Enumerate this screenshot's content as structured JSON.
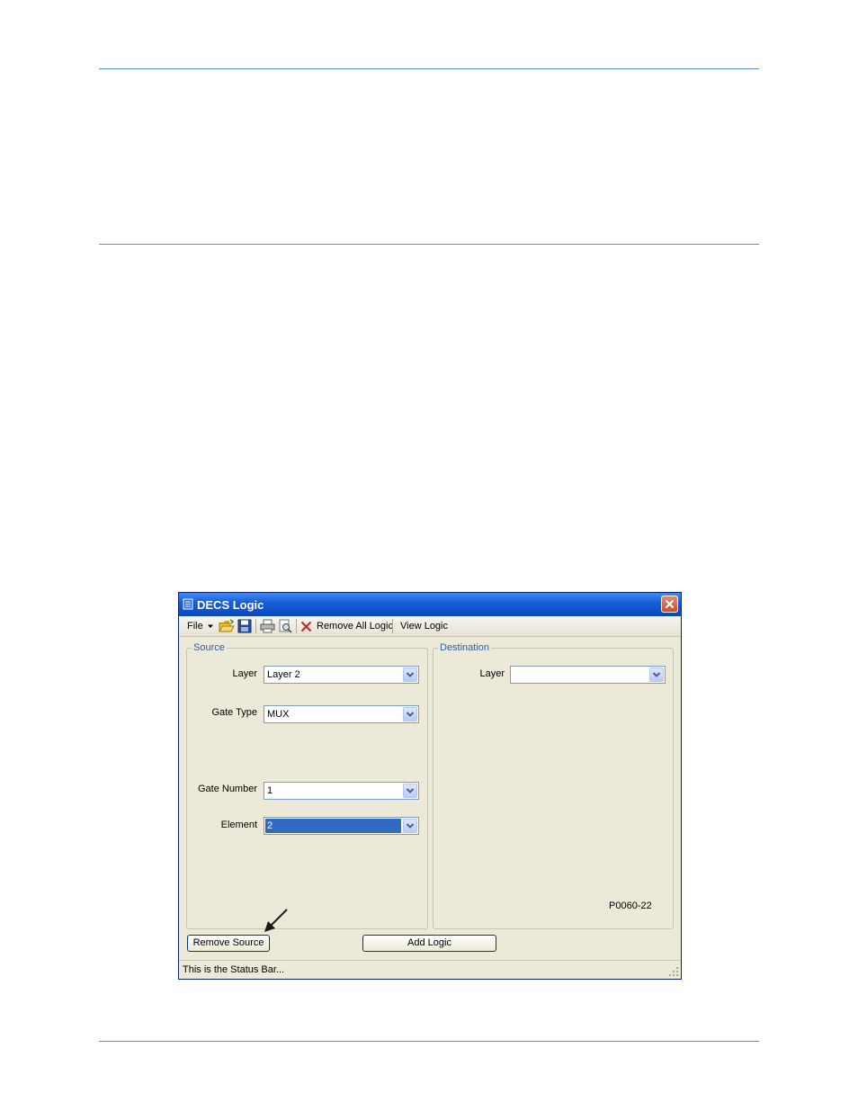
{
  "window": {
    "title": "DECS Logic",
    "icons": [
      "app-icon",
      "close-icon"
    ]
  },
  "toolbar": {
    "file_label": "File",
    "remove_all_logic_label": "Remove All Logic",
    "view_logic_label": "View Logic",
    "icons": [
      "dropdown-arrow-icon",
      "open-folder-icon",
      "save-icon",
      "print-icon",
      "print-preview-icon",
      "remove-x-icon"
    ]
  },
  "source": {
    "legend": "Source",
    "layer_label": "Layer",
    "layer_value": "Layer 2",
    "gate_type_label": "Gate Type",
    "gate_type_value": "MUX",
    "gate_number_label": "Gate Number",
    "gate_number_value": "1",
    "element_label": "Element",
    "element_value": "2"
  },
  "destination": {
    "legend": "Destination",
    "layer_label": "Layer",
    "layer_value": ""
  },
  "figure_id": "P0060-22",
  "buttons": {
    "remove_source": "Remove Source",
    "add_logic": "Add Logic"
  },
  "status_bar": "This is the Status Bar...",
  "colors": {
    "title_bar": "#0c4ec6",
    "window_face": "#ece9d8",
    "legend_text": "#2a5db0",
    "selection": "#316ac5",
    "page_rule": "#5b8fc9"
  }
}
